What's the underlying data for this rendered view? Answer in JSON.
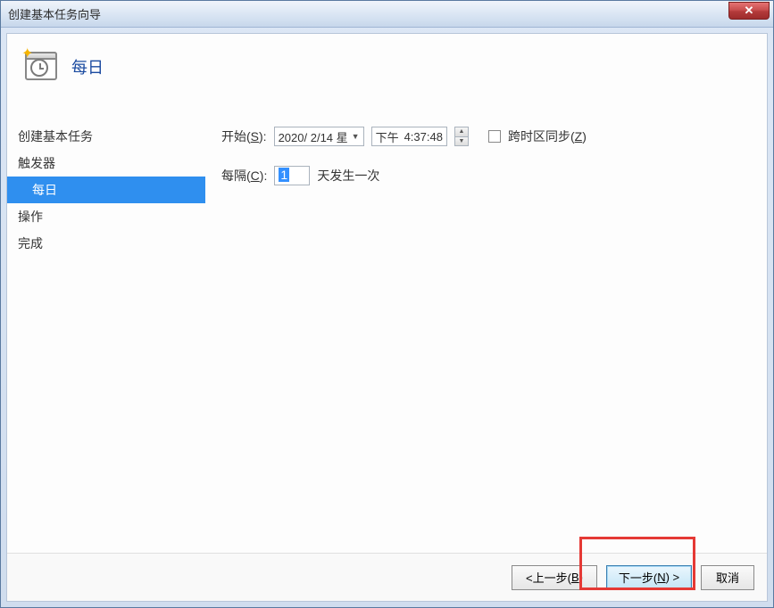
{
  "window": {
    "title": "创建基本任务向导"
  },
  "header": {
    "title": "每日"
  },
  "sidebar": {
    "items": [
      {
        "label": "创建基本任务",
        "sub": false,
        "active": false
      },
      {
        "label": "触发器",
        "sub": false,
        "active": false
      },
      {
        "label": "每日",
        "sub": true,
        "active": true
      },
      {
        "label": "操作",
        "sub": false,
        "active": false
      },
      {
        "label": "完成",
        "sub": false,
        "active": false
      }
    ]
  },
  "form": {
    "start_label_pre": "开始(",
    "start_label_key": "S",
    "start_label_post": "):",
    "date_value": "2020/ 2/14 星",
    "time_prefix": "下午",
    "time_value": "4:37:48",
    "sync_label_pre": "跨时区同步(",
    "sync_label_key": "Z",
    "sync_label_post": ")",
    "interval_label_pre": "每隔(",
    "interval_label_key": "C",
    "interval_label_post": "):",
    "interval_value": "1",
    "interval_suffix": "天发生一次"
  },
  "footer": {
    "back_pre": "<上一步(",
    "back_key": "B",
    "back_post": ")",
    "next_pre": "下一步(",
    "next_key": "N",
    "next_post": ") >",
    "cancel": "取消"
  }
}
